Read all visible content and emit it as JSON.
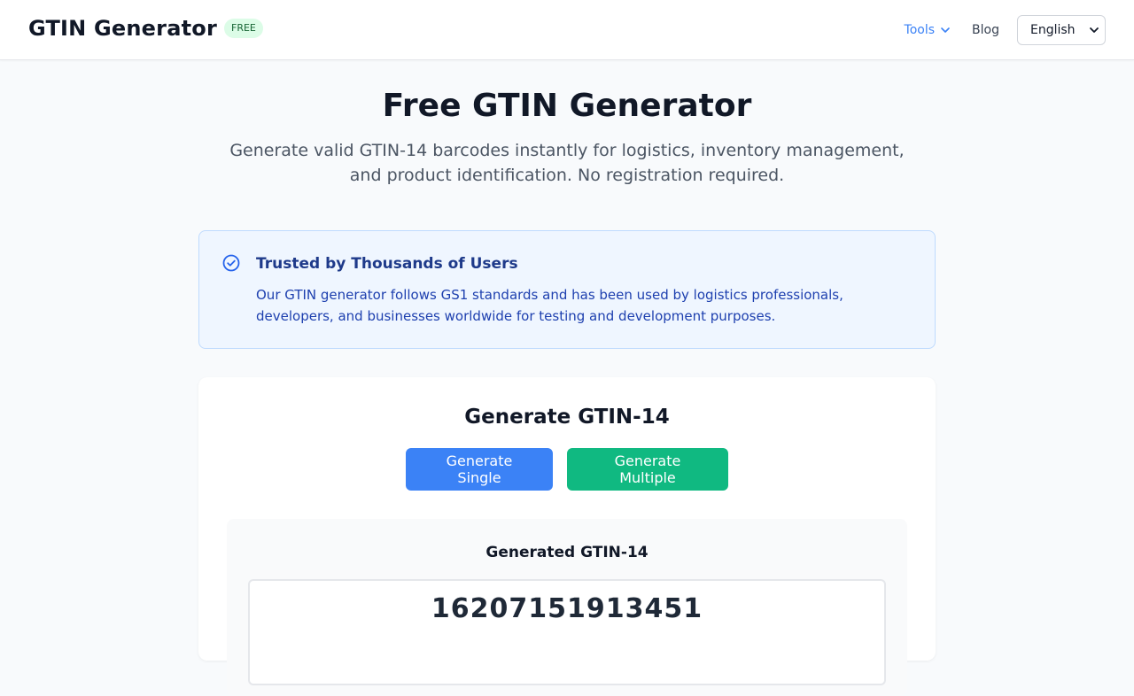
{
  "header": {
    "brand_name": "GTIN Generator",
    "badge": "FREE",
    "nav": {
      "tools_label": "Tools",
      "blog_label": "Blog"
    },
    "language": {
      "selected": "English"
    }
  },
  "hero": {
    "title": "Free GTIN Generator",
    "subtitle": "Generate valid GTIN-14 barcodes instantly for logistics, inventory management, and product identification. No registration required."
  },
  "trust": {
    "icon": "check-circle-icon",
    "title": "Trusted by Thousands of Users",
    "text": "Our GTIN generator follows GS1 standards and has been used by logistics professionals, developers, and businesses worldwide for testing and development purposes."
  },
  "generator": {
    "title": "Generate GTIN-14",
    "single_label": "Generate Single",
    "multiple_label": "Generate Multiple",
    "result_label": "Generated GTIN-14",
    "result_value": "16207151913451"
  },
  "colors": {
    "primary": "#3b82f6",
    "success": "#10b981",
    "badge_bg": "#dcfce7",
    "badge_text": "#166534",
    "trust_bg": "#eff6ff",
    "trust_text": "#1e40af"
  }
}
